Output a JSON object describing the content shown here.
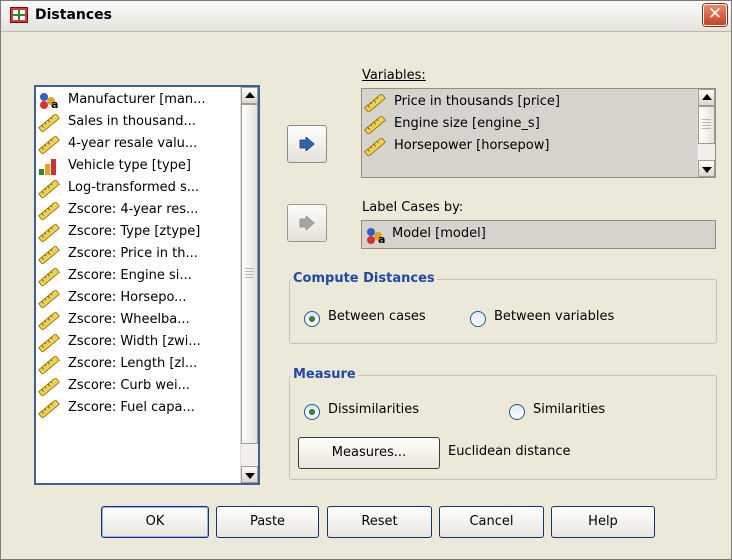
{
  "window": {
    "title": "Distances",
    "close_label": "✕"
  },
  "source_list": {
    "items": [
      {
        "icon": "nominal-icon",
        "label": "Manufacturer [man..."
      },
      {
        "icon": "scale-icon",
        "label": "Sales in thousand..."
      },
      {
        "icon": "scale-icon",
        "label": "4-year resale valu..."
      },
      {
        "icon": "ordinal-icon",
        "label": "Vehicle type [type]"
      },
      {
        "icon": "scale-icon",
        "label": "Log-transformed s..."
      },
      {
        "icon": "scale-icon",
        "label": "Zscore:  4-year res..."
      },
      {
        "icon": "scale-icon",
        "label": "Zscore:  Type [ztype]"
      },
      {
        "icon": "scale-icon",
        "label": "Zscore:  Price in th..."
      },
      {
        "icon": "scale-icon",
        "label": "Zscore:  Engine si..."
      },
      {
        "icon": "scale-icon",
        "label": "Zscore:  Horsepo..."
      },
      {
        "icon": "scale-icon",
        "label": "Zscore:  Wheelba..."
      },
      {
        "icon": "scale-icon",
        "label": "Zscore:  Width [zwi..."
      },
      {
        "icon": "scale-icon",
        "label": "Zscore:  Length [zl..."
      },
      {
        "icon": "scale-icon",
        "label": "Zscore:  Curb wei..."
      },
      {
        "icon": "scale-icon",
        "label": "Zscore:  Fuel capa..."
      }
    ]
  },
  "variables": {
    "label": "Variables:",
    "items": [
      {
        "icon": "scale-icon",
        "label": "Price in thousands [price]"
      },
      {
        "icon": "scale-icon",
        "label": "Engine size [engine_s]"
      },
      {
        "icon": "scale-icon",
        "label": "Horsepower [horsepow]"
      }
    ]
  },
  "label_cases": {
    "label": "Label Cases by:",
    "value": "Model [model]",
    "icon": "nominal-icon"
  },
  "compute": {
    "title": "Compute Distances",
    "options": [
      "Between cases",
      "Between variables"
    ],
    "selected": "Between cases"
  },
  "measure": {
    "title": "Measure",
    "options": [
      "Dissimilarities",
      "Similarities"
    ],
    "selected": "Dissimilarities",
    "button": "Measures...",
    "current": "Euclidean distance"
  },
  "buttons": {
    "ok": "OK",
    "paste": "Paste",
    "reset": "Reset",
    "cancel": "Cancel",
    "help": "Help"
  },
  "colors": {
    "accent": "#1f47b0",
    "titlebar_close": "#c8401f",
    "selection": "#d5d3cc"
  }
}
